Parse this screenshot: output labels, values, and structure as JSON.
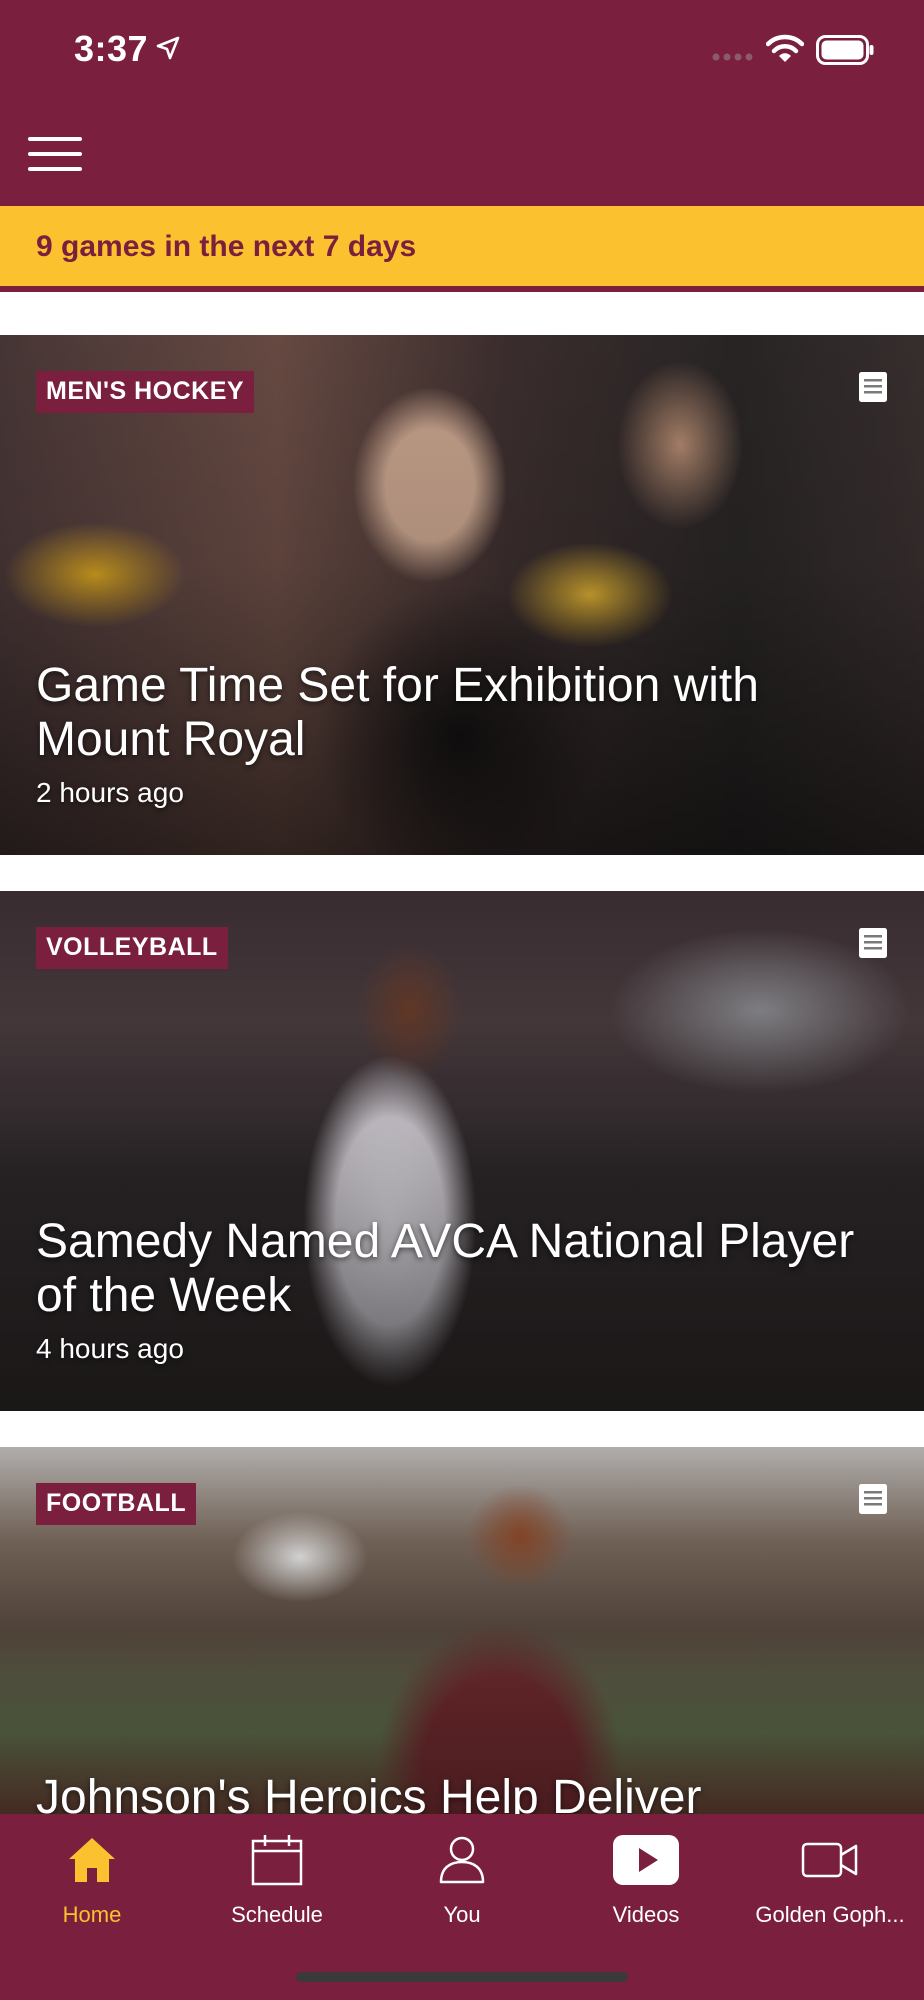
{
  "status": {
    "time": "3:37"
  },
  "banner": {
    "text": "9 games in the next 7 days"
  },
  "colors": {
    "brand_maroon": "#7a1f3d",
    "brand_gold": "#fcc12e"
  },
  "feed": [
    {
      "category": "MEN'S HOCKEY",
      "title": "Game Time Set for Exhibition with Mount Royal",
      "time": "2 hours ago",
      "icon": "article-icon"
    },
    {
      "category": "VOLLEYBALL",
      "title": "Samedy Named AVCA National Player of the Week",
      "time": "4 hours ago",
      "icon": "article-icon"
    },
    {
      "category": "FOOTBALL",
      "title": "Johnson's Heroics Help Deliver",
      "time": "",
      "icon": "article-icon"
    }
  ],
  "tabs": [
    {
      "label": "Home",
      "icon": "home-icon",
      "active": true
    },
    {
      "label": "Schedule",
      "icon": "calendar-icon",
      "active": false
    },
    {
      "label": "You",
      "icon": "person-icon",
      "active": false
    },
    {
      "label": "Videos",
      "icon": "play-icon",
      "active": false
    },
    {
      "label": "Golden Goph...",
      "icon": "video-camera-icon",
      "active": false
    }
  ]
}
